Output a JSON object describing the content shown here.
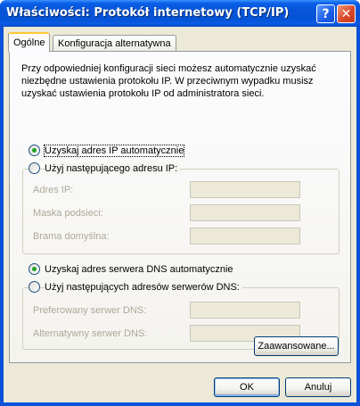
{
  "window": {
    "title": "Właściwości: Protokół internetowy (TCP/IP)",
    "help_glyph": "?",
    "close_glyph": "✕"
  },
  "tabs": [
    {
      "label": "Ogólne",
      "active": true
    },
    {
      "label": "Konfiguracja alternatywna",
      "active": false
    }
  ],
  "general": {
    "description": "Przy odpowiedniej konfiguracji sieci możesz automatycznie uzyskać niezbędne ustawienia protokołu IP. W przeciwnym wypadku musisz uzyskać ustawienia protokołu IP od administratora sieci.",
    "ip_auto_label": "Uzyskaj adres IP automatycznie",
    "ip_auto_selected": true,
    "ip_manual_label": "Użyj następującego adresu IP:",
    "ip_address_label": "Adres IP:",
    "subnet_mask_label": "Maska podsieci:",
    "gateway_label": "Brama domyślna:",
    "dns_auto_label": "Uzyskaj adres serwera DNS automatycznie",
    "dns_auto_selected": true,
    "dns_manual_label": "Użyj następujących adresów serwerów DNS:",
    "preferred_dns_label": "Preferowany serwer DNS:",
    "alternate_dns_label": "Alternatywny serwer DNS:",
    "advanced_button": "Zaawansowane..."
  },
  "footer": {
    "ok_button": "OK",
    "cancel_button": "Anuluj"
  },
  "colors": {
    "titlebar": "#0a53d8",
    "dialog_bg": "#ece9d8",
    "tab_highlight": "#ffc73c",
    "radio_dot": "#21a121",
    "disabled_text": "#aca899"
  }
}
